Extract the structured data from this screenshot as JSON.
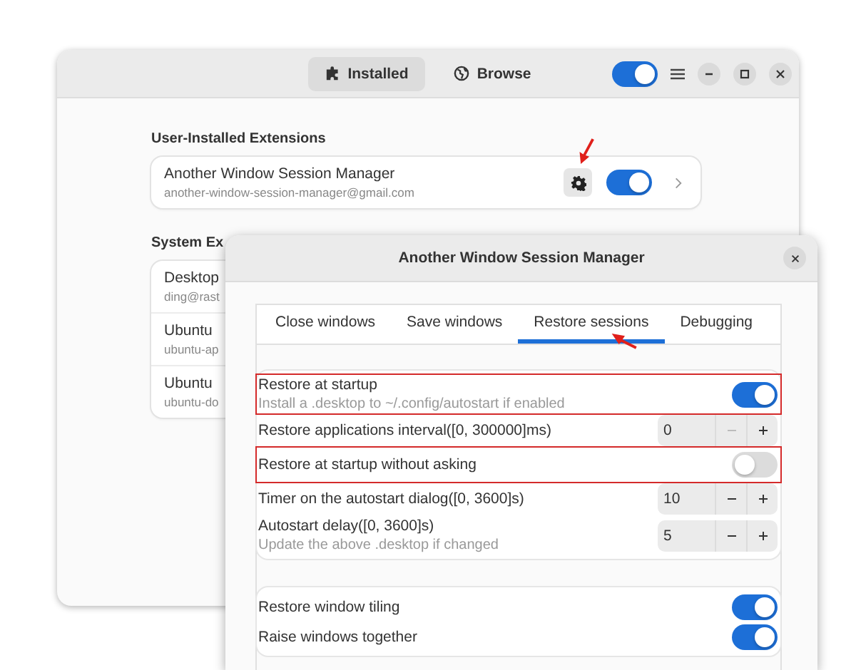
{
  "main_window": {
    "tabs": [
      {
        "label": "Installed",
        "selected": true
      },
      {
        "label": "Browse",
        "selected": false
      }
    ],
    "extensions_on": true,
    "sections": [
      {
        "heading": "User-Installed Extensions",
        "extensions": [
          {
            "name": "Another Window Session Manager",
            "id": "another-window-session-manager@gmail.com",
            "enabled": true
          }
        ]
      },
      {
        "heading": "System Ex",
        "extensions": [
          {
            "name": "Desktop",
            "id": "ding@rast"
          },
          {
            "name": "Ubuntu",
            "id": "ubuntu-ap"
          },
          {
            "name": "Ubuntu",
            "id": "ubuntu-do"
          }
        ]
      }
    ]
  },
  "dialog": {
    "title": "Another Window Session Manager",
    "tabs": [
      {
        "label": "Close windows",
        "selected": false
      },
      {
        "label": "Save windows",
        "selected": false
      },
      {
        "label": "Restore sessions",
        "selected": true
      },
      {
        "label": "Debugging",
        "selected": false
      }
    ],
    "groups": [
      {
        "rows": [
          {
            "kind": "switch",
            "label": "Restore at startup",
            "subtitle": "Install a .desktop to ~/.config/autostart if enabled",
            "on": true,
            "highlighted": true
          },
          {
            "kind": "spin",
            "label": "Restore applications interval([0, 300000]ms)",
            "value": "0",
            "minus_disabled": true,
            "highlighted": false
          },
          {
            "kind": "switch",
            "label": "Restore at startup without asking",
            "on": false,
            "highlighted": true
          },
          {
            "kind": "spin",
            "label": "Timer on the autostart dialog([0, 3600]s)",
            "value": "10",
            "minus_disabled": false,
            "highlighted": false
          },
          {
            "kind": "spin",
            "label": "Autostart delay([0, 3600]s)",
            "subtitle": "Update the above .desktop if changed",
            "value": "5",
            "minus_disabled": false,
            "highlighted": false
          }
        ]
      },
      {
        "rows": [
          {
            "kind": "switch",
            "label": "Restore window tiling",
            "on": true,
            "highlighted": false
          },
          {
            "kind": "switch",
            "label": "Raise windows together",
            "on": true,
            "highlighted": false
          }
        ]
      }
    ]
  }
}
